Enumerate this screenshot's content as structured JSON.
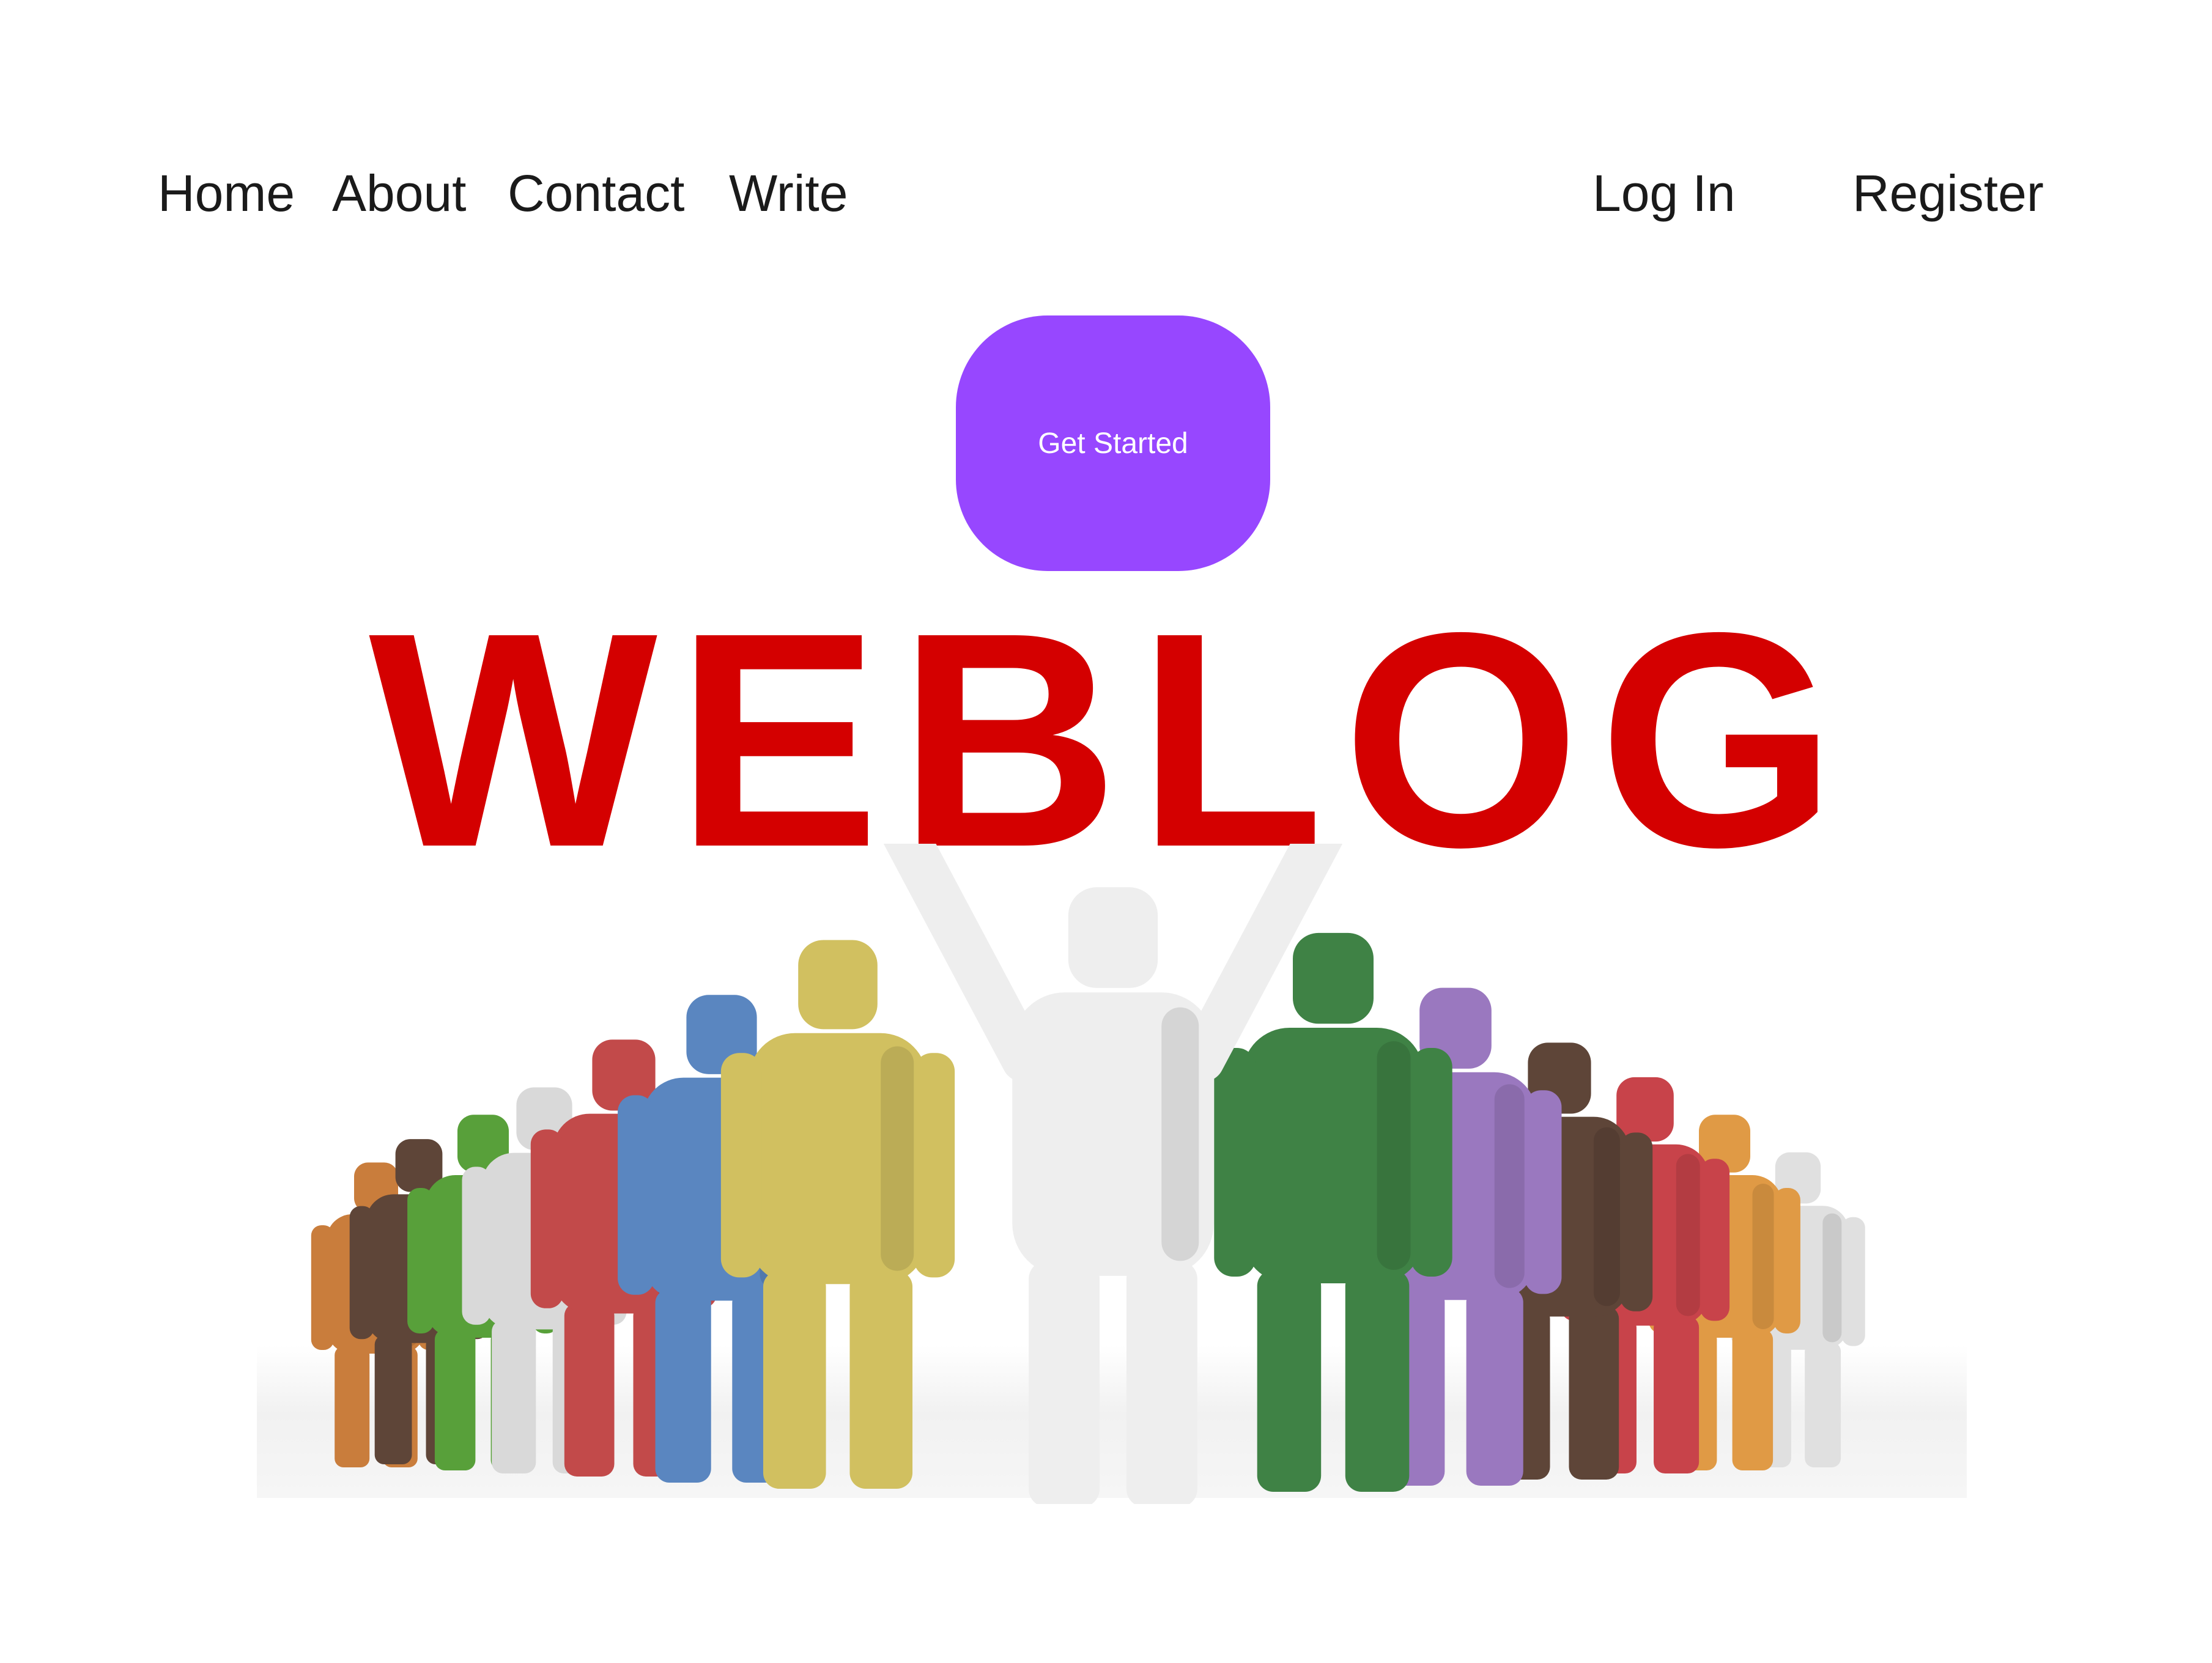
{
  "nav": {
    "home": "Home",
    "about": "About",
    "contact": "Contact",
    "write": "Write",
    "login": "Log In",
    "register": "Register"
  },
  "cta": {
    "label": "Get Started"
  },
  "hero": {
    "title": "WEBLOG",
    "image_icon": "crowd-of-people-illustration"
  },
  "colors": {
    "accent": "#9747ff",
    "hero_title": "#d40000",
    "text": "#1a1a1a",
    "background": "#ffffff",
    "figures": [
      "#c97d3c",
      "#5e4538",
      "#58a03a",
      "#d9d9d9",
      "#c24a4a",
      "#5a86c0",
      "#d1c060",
      "#eeeeee",
      "#3f8245",
      "#9a78bf",
      "#5e4538",
      "#c8434a",
      "#e09a45",
      "#e0e0e0"
    ]
  }
}
